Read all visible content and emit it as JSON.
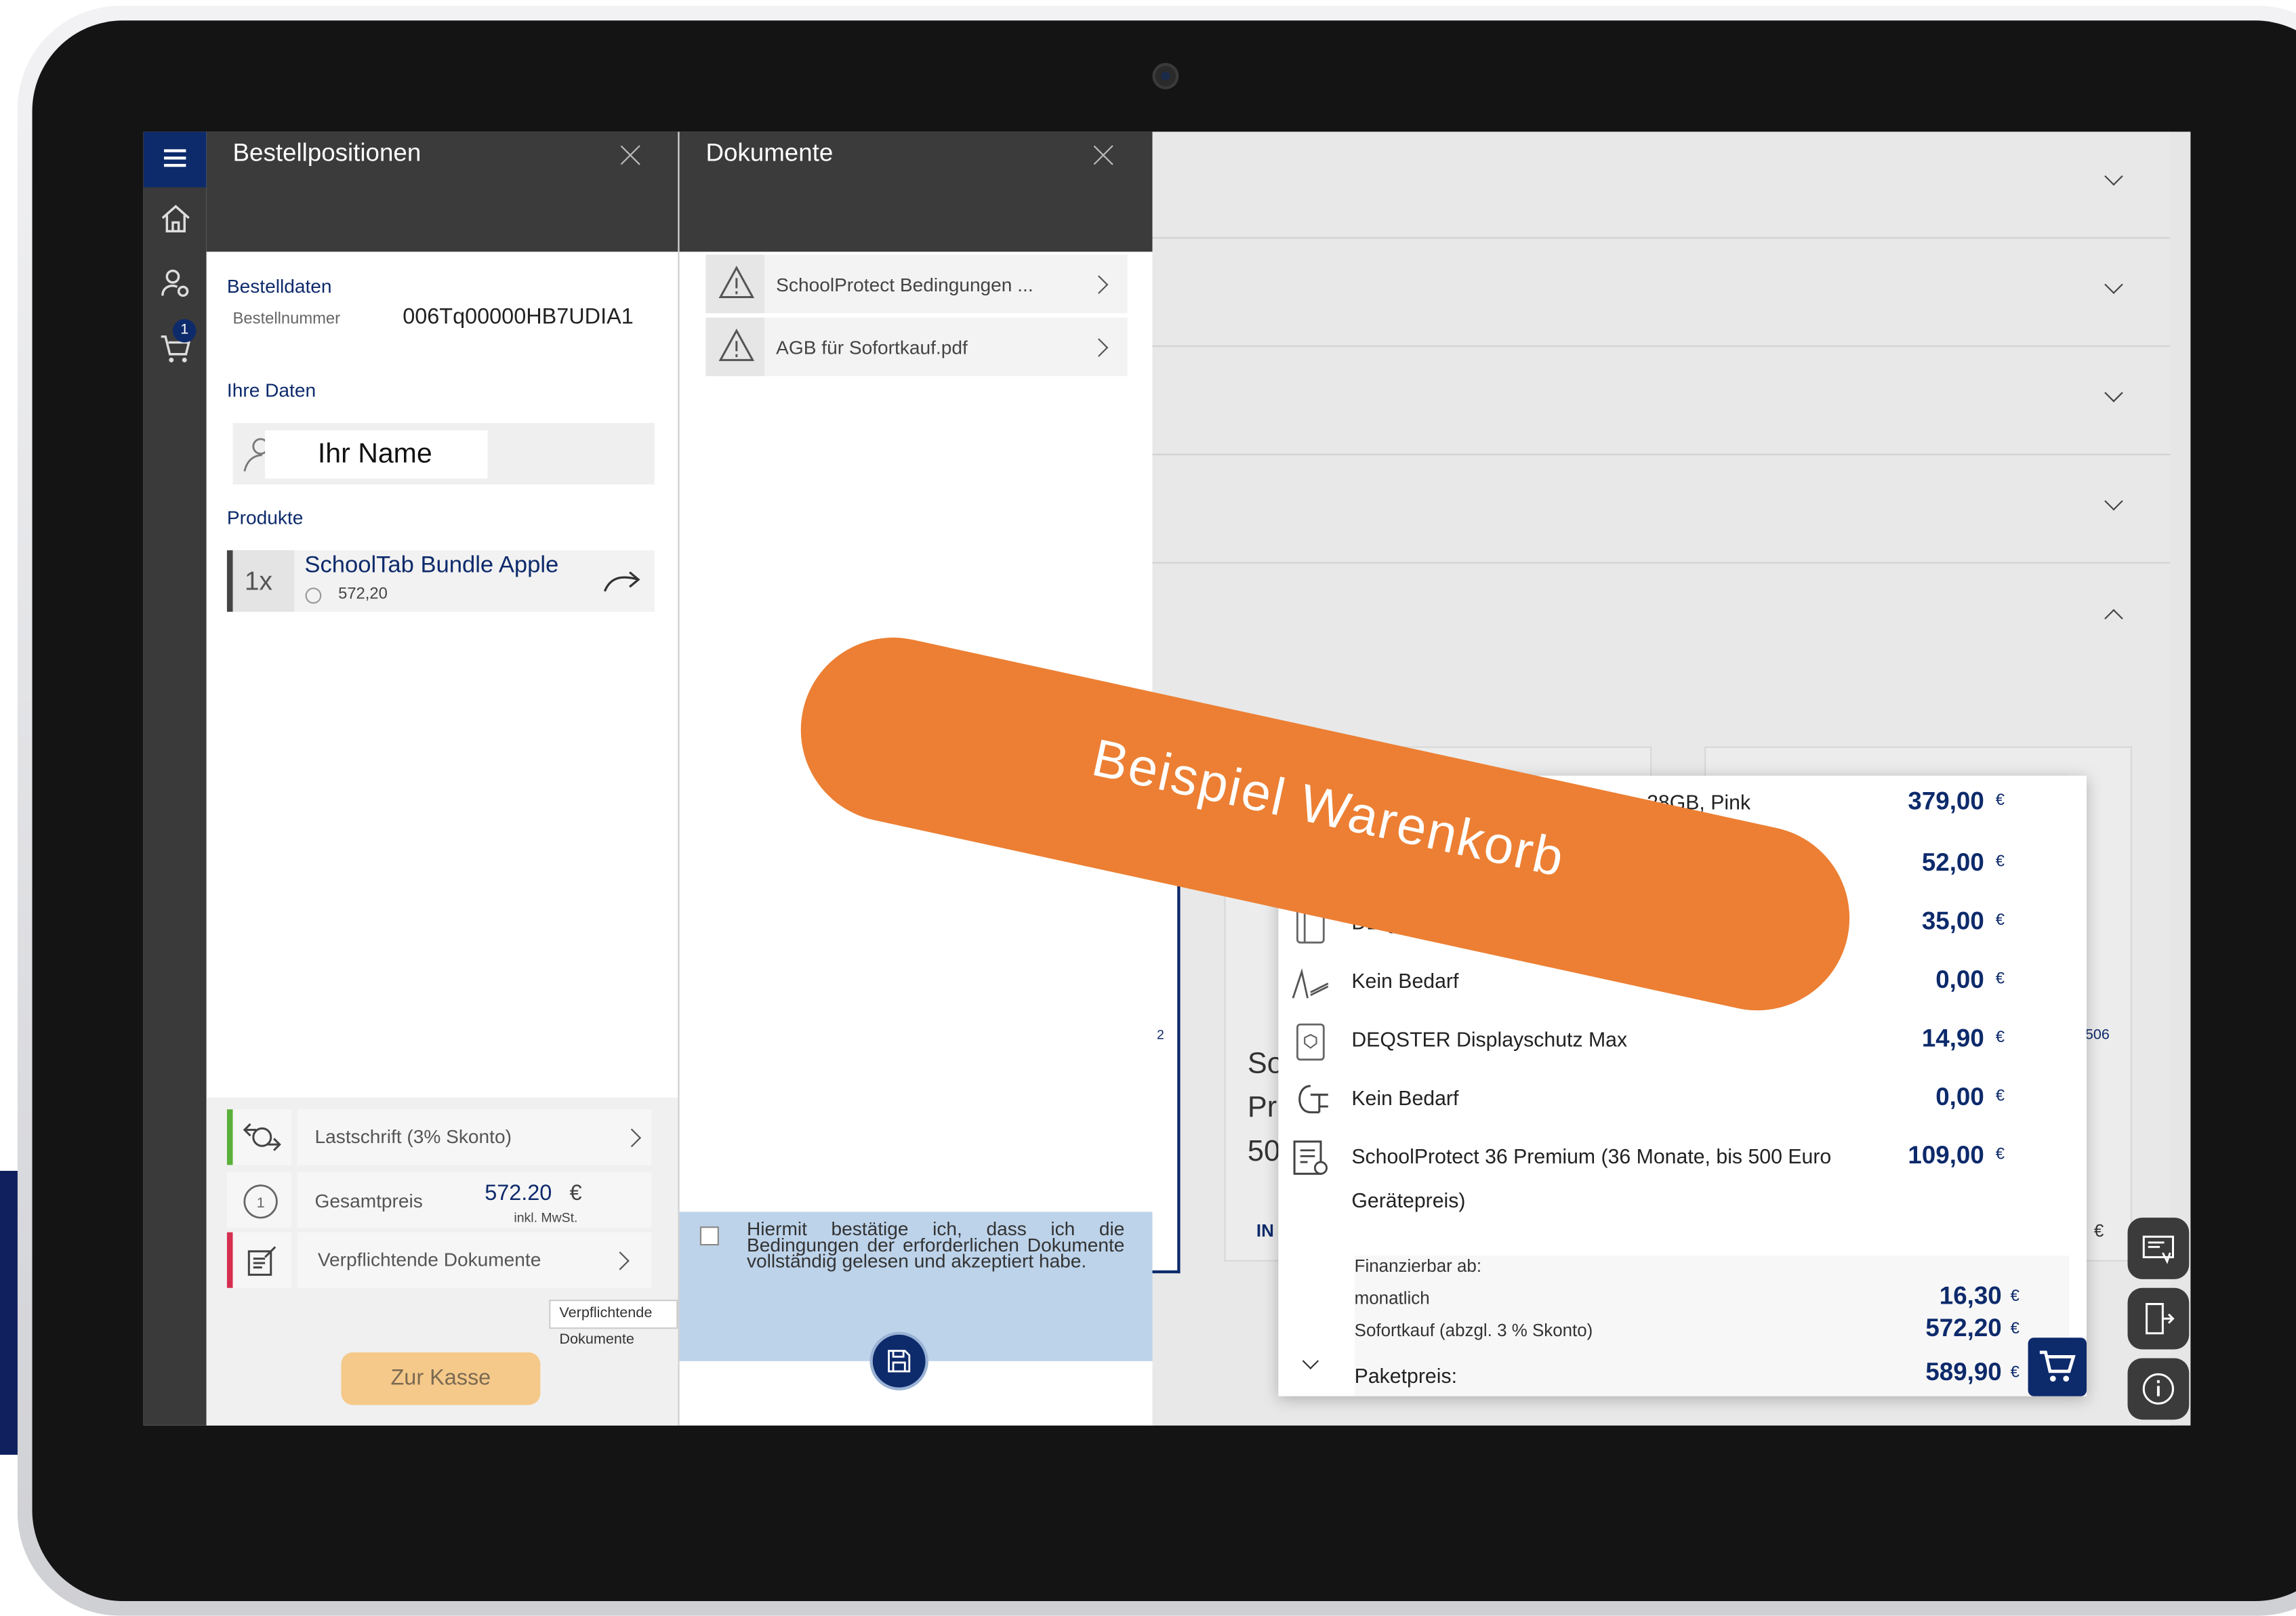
{
  "banner": {
    "text": "Beispiel Warenkorb"
  },
  "sidebar": {
    "cart_count": "1"
  },
  "order_panel": {
    "title": "Bestellpositionen",
    "order_data_label": "Bestelldaten",
    "order_number_label": "Bestellnummer",
    "order_number": "006Tq00000HB7UDIA1",
    "your_data_label": "Ihre Daten",
    "name_value": "Ihr Name",
    "products_label": "Produkte",
    "product": {
      "qty": "1x",
      "name": "SchoolTab Bundle Apple",
      "price": "572,20"
    },
    "payment_label": "Lastschrift (3% Skonto)",
    "total_label": "Gesamtpreis",
    "total_value": "572.20",
    "total_currency": "€",
    "total_note": "inkl. MwSt.",
    "documents_label": "Verpflichtende Dokumente",
    "tooltip": "Verpflichtende Dokumente",
    "checkout_label": "Zur Kasse"
  },
  "documents_panel": {
    "title": "Dokumente",
    "items": [
      {
        "label": "SchoolProtect Bedingungen ..."
      },
      {
        "label": "AGB für Sofortkauf.pdf"
      }
    ],
    "confirm_text": "Hiermit bestätige ich, dass ich die Bedingungen der erforderlichen Dokumente vollständig gelesen und akzeptiert habe."
  },
  "background": {
    "partial_texts": [
      "So",
      "Pr",
      "50",
      "IN",
      "2",
      "506",
      "€"
    ]
  },
  "price_popup": {
    "items": [
      {
        "name": "...28GB, Pink",
        "price": "379,00",
        "currency": "€",
        "icon": "tablet-icon"
      },
      {
        "name": "",
        "price": "52,00",
        "currency": "€",
        "icon": "pencil-icon"
      },
      {
        "name": "DEQSTER Rug...",
        "price": "35,00",
        "currency": "€",
        "icon": "case-icon"
      },
      {
        "name": "Kein Bedarf",
        "price": "0,00",
        "currency": "€",
        "icon": "stylus-icon"
      },
      {
        "name": "DEQSTER Displayschutz Max",
        "price": "14,90",
        "currency": "€",
        "icon": "screen-protector-icon"
      },
      {
        "name": "Kein Bedarf",
        "price": "0,00",
        "currency": "€",
        "icon": "charger-icon"
      },
      {
        "name": "SchoolProtect 36 Premium (36 Monate, bis 500 Euro",
        "name2": "Gerätepreis)",
        "price": "109,00",
        "currency": "€",
        "icon": "certificate-icon"
      }
    ],
    "finance_label": "Finanzierbar ab:",
    "monthly_label": "monatlich",
    "monthly_value": "16,30",
    "instant_label": "Sofortkauf (abzgl. 3 % Skonto)",
    "instant_value": "572,20",
    "package_label": "Paketpreis:",
    "package_value": "589,90",
    "currency": "€"
  }
}
